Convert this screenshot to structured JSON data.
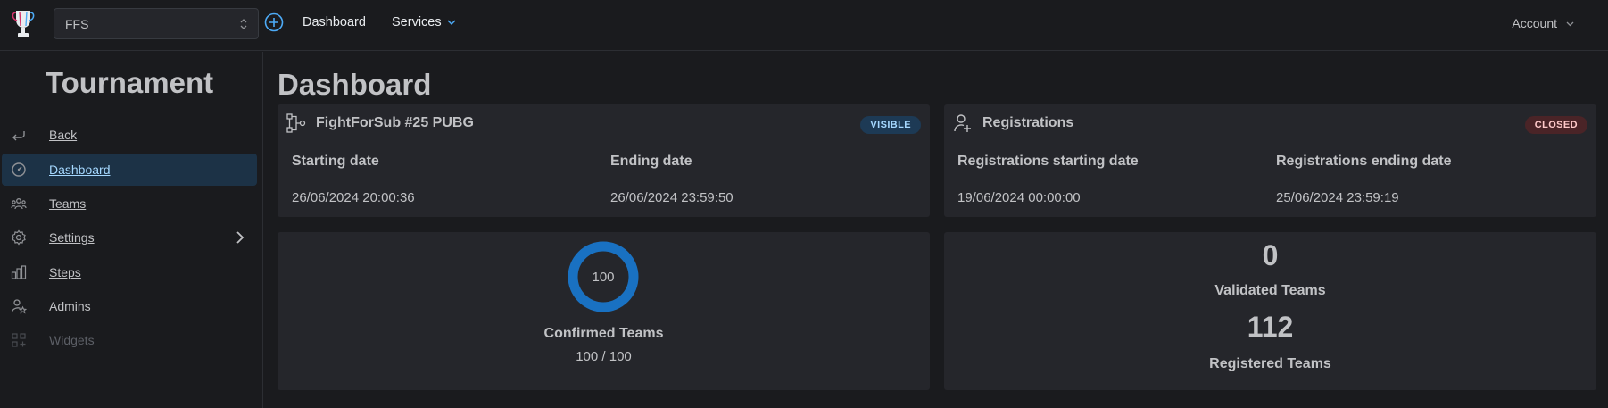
{
  "topbar": {
    "org_select": {
      "value": "FFS"
    },
    "nav": {
      "dashboard": "Dashboard",
      "services": "Services"
    },
    "account": "Account"
  },
  "sidebar": {
    "title": "Tournament",
    "items": [
      {
        "label": "Back",
        "icon": "back-arrow-icon"
      },
      {
        "label": "Dashboard",
        "icon": "gauge-icon",
        "active": true
      },
      {
        "label": "Teams",
        "icon": "users-icon"
      },
      {
        "label": "Settings",
        "icon": "gear-icon"
      },
      {
        "label": "Steps",
        "icon": "bar-chart-icon"
      },
      {
        "label": "Admins",
        "icon": "user-star-icon"
      },
      {
        "label": "Widgets",
        "icon": "widgets-icon",
        "disabled": true
      }
    ]
  },
  "main": {
    "title": "Dashboard",
    "tournament_card": {
      "name": "FightForSub #25 PUBG",
      "badge": "VISIBLE",
      "start_label": "Starting date",
      "end_label": "Ending date",
      "start_value": "26/06/2024 20:00:36",
      "end_value": "26/06/2024 23:59:50"
    },
    "registrations_card": {
      "title": "Registrations",
      "badge": "CLOSED",
      "start_label": "Registrations starting date",
      "end_label": "Registrations ending date",
      "start_value": "19/06/2024 00:00:00",
      "end_value": "25/06/2024 23:59:19"
    },
    "confirmed_card": {
      "ring_value": "100",
      "ring_progress": 1.0,
      "label": "Confirmed Teams",
      "ratio": "100 / 100"
    },
    "stats_card": {
      "validated_count": "0",
      "validated_label": "Validated Teams",
      "registered_count": "112",
      "registered_label": "Registered Teams"
    }
  },
  "colors": {
    "background": "#1a1b1e",
    "card": "#25262b",
    "accent": "#1971c2",
    "active_nav_bg": "#1c3246",
    "badge_visible": "#1d3a55",
    "badge_closed": "#4a2427"
  }
}
